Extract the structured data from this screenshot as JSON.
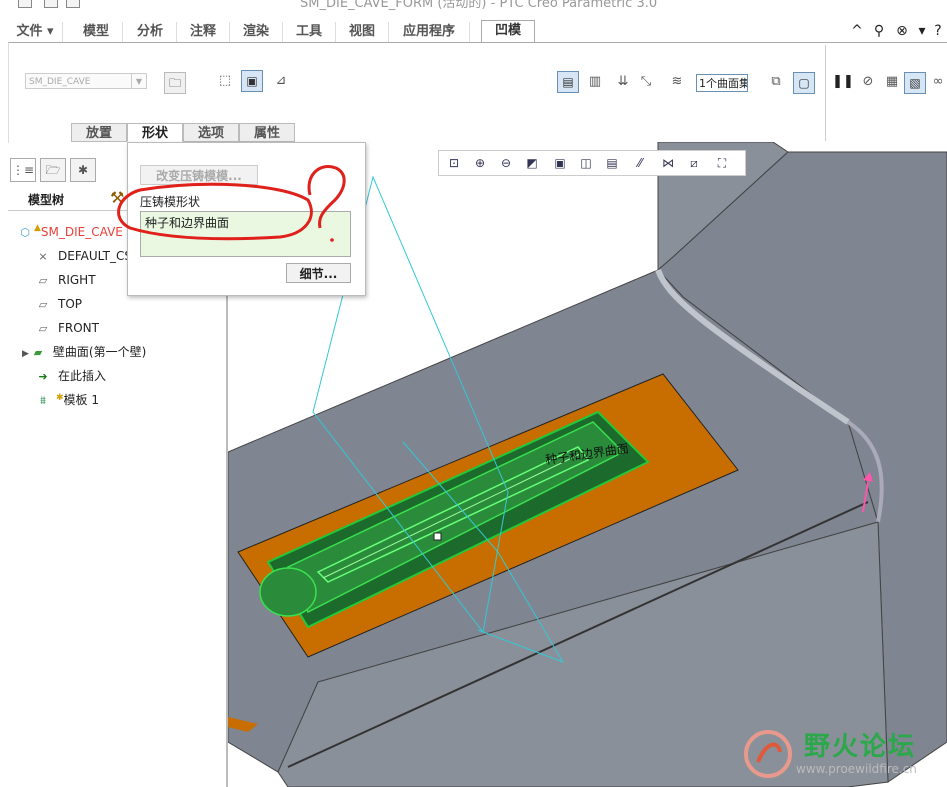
{
  "window": {
    "title": "SM_DIE_CAVE_FORM (活动的) - PTC Creo Parametric 3.0"
  },
  "ribbon_tabs": [
    {
      "label": "文件"
    },
    {
      "label": "模型"
    },
    {
      "label": "分析"
    },
    {
      "label": "注释"
    },
    {
      "label": "渲染"
    },
    {
      "label": "工具"
    },
    {
      "label": "视图"
    },
    {
      "label": "应用程序"
    },
    {
      "label": "凹模"
    }
  ],
  "dashboard": {
    "reference_select": {
      "value": "SM_DIE_CAVE"
    },
    "surface_collector": {
      "value": "1个曲面集"
    },
    "subtabs": [
      {
        "label": "放置"
      },
      {
        "label": "形状"
      },
      {
        "label": "选项"
      },
      {
        "label": "属性"
      }
    ]
  },
  "shape_panel": {
    "change_button": "改变压铸模模...",
    "shape_label": "压铸模形状",
    "shape_value": "种子和边界曲面",
    "details_button": "细节..."
  },
  "model_tree": {
    "header": "模型树",
    "items": [
      {
        "label": "SM_DIE_CAVE",
        "icon": "part-icon",
        "color": "#e8413a"
      },
      {
        "label": "DEFAULT_CSYS",
        "icon": "csys-icon"
      },
      {
        "label": "RIGHT",
        "icon": "datum-plane-icon"
      },
      {
        "label": "TOP",
        "icon": "datum-plane-icon"
      },
      {
        "label": "FRONT",
        "icon": "datum-plane-icon"
      },
      {
        "label": "壁曲面(第一个壁)",
        "icon": "wall-icon"
      },
      {
        "label": "在此插入",
        "icon": "insert-arrow-icon"
      },
      {
        "label": "模板 1",
        "icon": "die-form-icon"
      }
    ]
  },
  "model_annotation": "种子和边界曲面",
  "watermark": {
    "brand": "野火论坛",
    "url": "www.proewildfire.cn"
  },
  "colors": {
    "model_gray": "#7f8591",
    "orange_surface": "#c86e00",
    "die_green": "#1d6b2c",
    "datum_cyan": "#34c8d4",
    "markup_red": "#e0201a"
  }
}
